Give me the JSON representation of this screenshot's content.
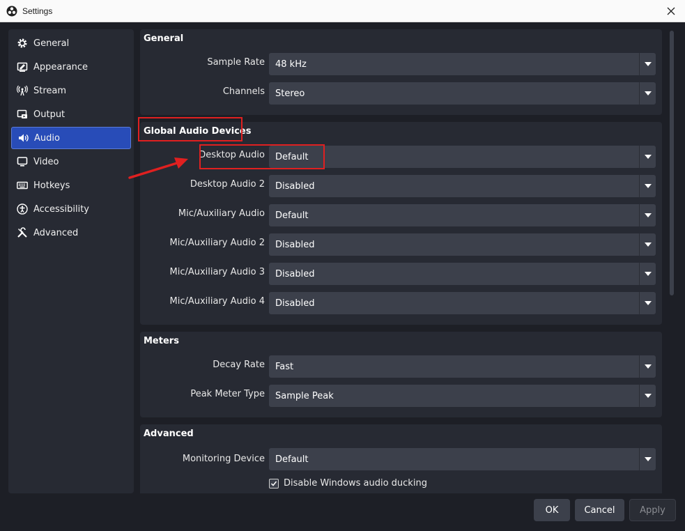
{
  "window": {
    "title": "Settings"
  },
  "sidebar": {
    "items": [
      {
        "label": "General",
        "icon": "gear-icon",
        "active": false
      },
      {
        "label": "Appearance",
        "icon": "appearance-icon",
        "active": false
      },
      {
        "label": "Stream",
        "icon": "antenna-icon",
        "active": false
      },
      {
        "label": "Output",
        "icon": "output-icon",
        "active": false
      },
      {
        "label": "Audio",
        "icon": "speaker-icon",
        "active": true
      },
      {
        "label": "Video",
        "icon": "monitor-icon",
        "active": false
      },
      {
        "label": "Hotkeys",
        "icon": "keyboard-icon",
        "active": false
      },
      {
        "label": "Accessibility",
        "icon": "accessibility-icon",
        "active": false
      },
      {
        "label": "Advanced",
        "icon": "tools-icon",
        "active": false
      }
    ]
  },
  "sections": {
    "general": {
      "title": "General",
      "rows": [
        {
          "label": "Sample Rate",
          "value": "48 kHz"
        },
        {
          "label": "Channels",
          "value": "Stereo"
        }
      ]
    },
    "global_audio": {
      "title": "Global Audio Devices",
      "rows": [
        {
          "label": "Desktop Audio",
          "value": "Default"
        },
        {
          "label": "Desktop Audio 2",
          "value": "Disabled"
        },
        {
          "label": "Mic/Auxiliary Audio",
          "value": "Default"
        },
        {
          "label": "Mic/Auxiliary Audio 2",
          "value": "Disabled"
        },
        {
          "label": "Mic/Auxiliary Audio 3",
          "value": "Disabled"
        },
        {
          "label": "Mic/Auxiliary Audio 4",
          "value": "Disabled"
        }
      ]
    },
    "meters": {
      "title": "Meters",
      "rows": [
        {
          "label": "Decay Rate",
          "value": "Fast"
        },
        {
          "label": "Peak Meter Type",
          "value": "Sample Peak"
        }
      ]
    },
    "advanced": {
      "title": "Advanced",
      "rows": [
        {
          "label": "Monitoring Device",
          "value": "Default"
        }
      ],
      "checkbox": {
        "label": "Disable Windows audio ducking",
        "checked": true
      }
    }
  },
  "buttons": {
    "ok": "OK",
    "cancel": "Cancel",
    "apply": "Apply"
  },
  "colors": {
    "accent": "#284cb8",
    "annotation": "#e02020",
    "panel": "#272a33",
    "combo": "#3c404b"
  }
}
